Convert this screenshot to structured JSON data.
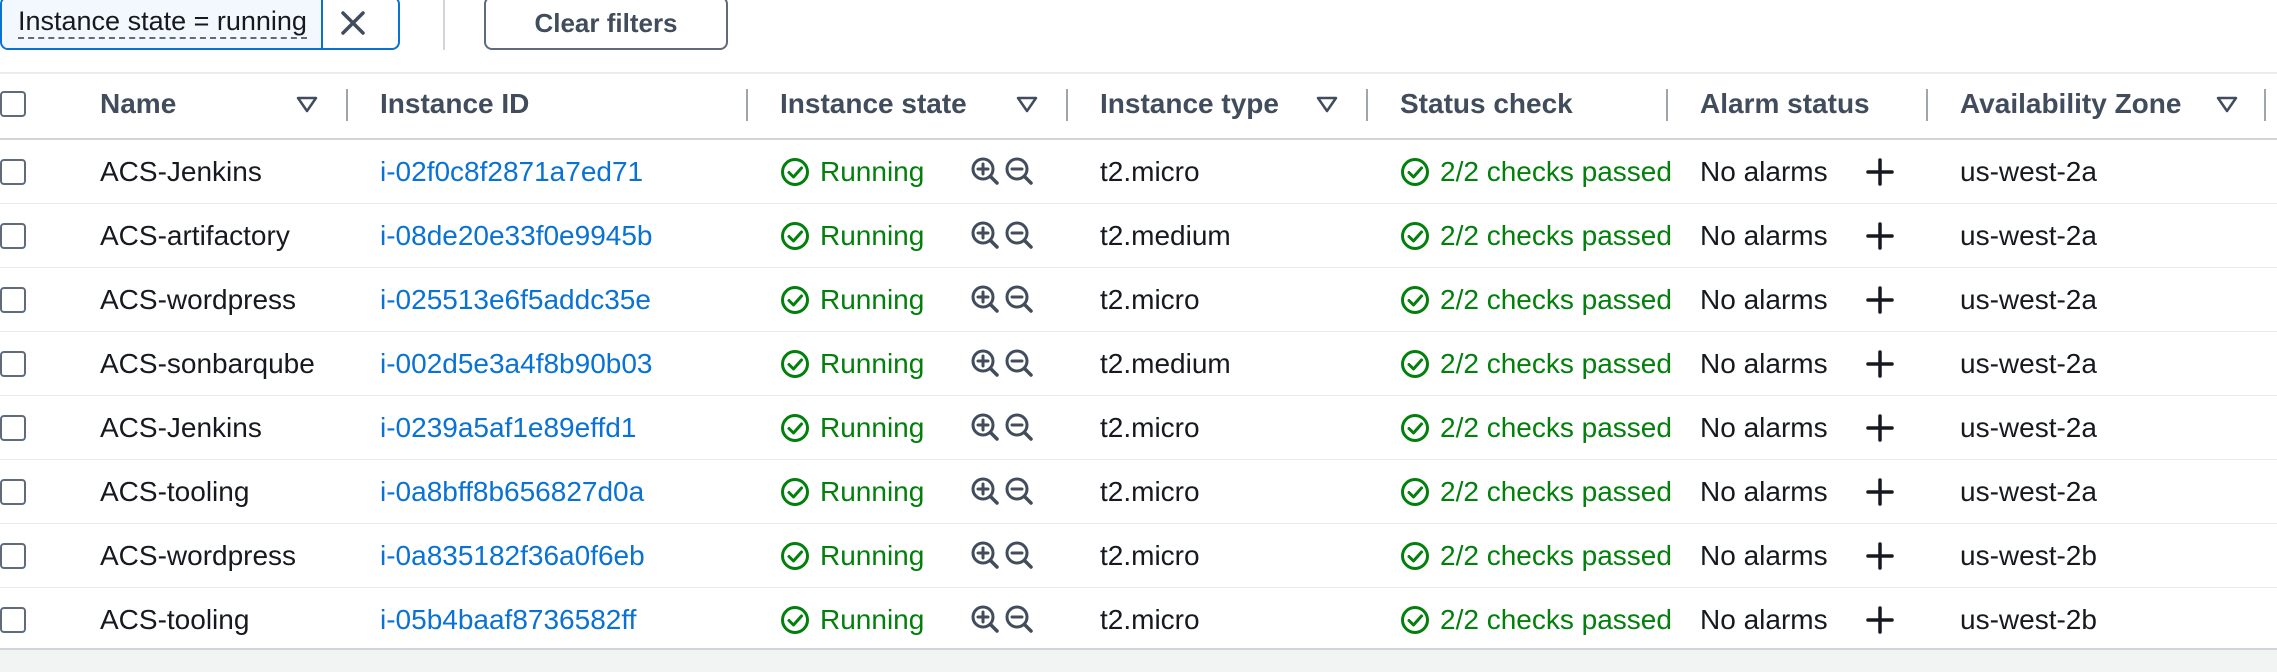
{
  "filter": {
    "token_label": "Instance state = running",
    "clear_label": "Clear filters"
  },
  "table": {
    "headers": {
      "name": "Name",
      "instance_id": "Instance ID",
      "instance_state": "Instance state",
      "instance_type": "Instance type",
      "status_check": "Status check",
      "alarm_status": "Alarm status",
      "availability_zone": "Availability Zone"
    },
    "rows": [
      {
        "name": "ACS-Jenkins",
        "instance_id": "i-02f0c8f2871a7ed71",
        "state": "Running",
        "type": "t2.micro",
        "status": "2/2 checks passed",
        "alarm": "No alarms",
        "zone": "us-west-2a"
      },
      {
        "name": "ACS-artifactory",
        "instance_id": "i-08de20e33f0e9945b",
        "state": "Running",
        "type": "t2.medium",
        "status": "2/2 checks passed",
        "alarm": "No alarms",
        "zone": "us-west-2a"
      },
      {
        "name": "ACS-wordpress",
        "instance_id": "i-025513e6f5addc35e",
        "state": "Running",
        "type": "t2.micro",
        "status": "2/2 checks passed",
        "alarm": "No alarms",
        "zone": "us-west-2a"
      },
      {
        "name": "ACS-sonbarqube",
        "instance_id": "i-002d5e3a4f8b90b03",
        "state": "Running",
        "type": "t2.medium",
        "status": "2/2 checks passed",
        "alarm": "No alarms",
        "zone": "us-west-2a"
      },
      {
        "name": "ACS-Jenkins",
        "instance_id": "i-0239a5af1e89effd1",
        "state": "Running",
        "type": "t2.micro",
        "status": "2/2 checks passed",
        "alarm": "No alarms",
        "zone": "us-west-2a"
      },
      {
        "name": "ACS-tooling",
        "instance_id": "i-0a8bff8b656827d0a",
        "state": "Running",
        "type": "t2.micro",
        "status": "2/2 checks passed",
        "alarm": "No alarms",
        "zone": "us-west-2a"
      },
      {
        "name": "ACS-wordpress",
        "instance_id": "i-0a835182f36a0f6eb",
        "state": "Running",
        "type": "t2.micro",
        "status": "2/2 checks passed",
        "alarm": "No alarms",
        "zone": "us-west-2b"
      },
      {
        "name": "ACS-tooling",
        "instance_id": "i-05b4baaf8736582ff",
        "state": "Running",
        "type": "t2.micro",
        "status": "2/2 checks passed",
        "alarm": "No alarms",
        "zone": "us-west-2b"
      }
    ]
  },
  "icons": {
    "state": "check-circle-icon",
    "zoom_in": "zoom-in-icon",
    "zoom_out": "zoom-out-icon",
    "add_alarm": "plus-icon",
    "sort": "caret-down-icon",
    "dismiss": "close-icon"
  },
  "colors": {
    "link": "#0972d3",
    "success": "#037f0c",
    "header_text": "#414d5c"
  }
}
